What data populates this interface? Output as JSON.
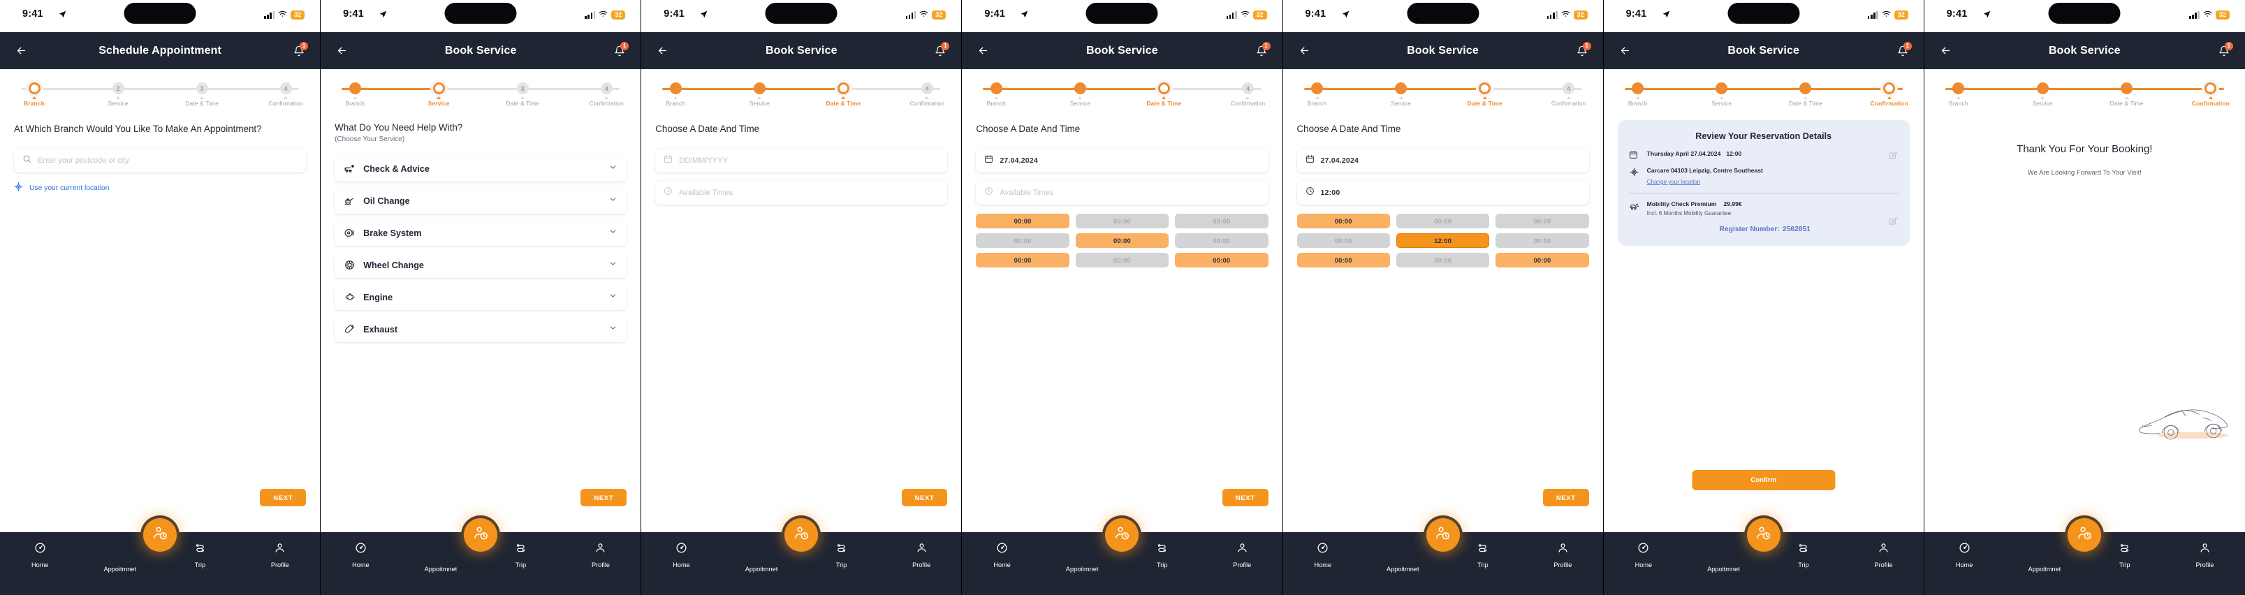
{
  "status_bar": {
    "time": "9:41",
    "battery": "32",
    "location_icon": "navigation-arrow-icon",
    "wifi_icon": "wifi-icon",
    "signal_icon": "signal-bars-icon"
  },
  "tabbar": {
    "home": "Home",
    "appointment": "Appoitmnet",
    "trip": "Trip",
    "profile": "Profile"
  },
  "colors": {
    "accent": "#f5941d",
    "accent_light": "#fbb163",
    "header_bg": "#1f2533",
    "slot_busy": "#d3d4d6",
    "link_blue": "#2a6fe0",
    "card_bg": "#e9edf7"
  },
  "steps": {
    "branch": "Branch",
    "service": "Service",
    "date_time": "Date & Time",
    "confirmation": "Confirmation"
  },
  "screens": [
    {
      "id": "branch",
      "title": "Schedule Appointment",
      "notification_count": "1",
      "active_step": 0,
      "question": "At Which Branch Would You Like To Make An Appointment?",
      "search_placeholder": "Enter your postcode or city",
      "current_location_label": "Use your current location",
      "next_label": "NEXT"
    },
    {
      "id": "service",
      "title": "Book Service",
      "notification_count": "1",
      "active_step": 1,
      "question": "What Do You Need Help With?",
      "subtitle": "(Choose Your Service)",
      "services": [
        {
          "label": "Check & Advice",
          "icon": "car-check-icon"
        },
        {
          "label": "Oil Change",
          "icon": "oil-can-icon"
        },
        {
          "label": "Brake System",
          "icon": "brake-disc-icon"
        },
        {
          "label": "Wheel Change",
          "icon": "wheel-icon"
        },
        {
          "label": "Engine",
          "icon": "engine-icon"
        },
        {
          "label": "Exhaust",
          "icon": "exhaust-icon"
        }
      ],
      "next_label": "NEXT"
    },
    {
      "id": "datetime-empty",
      "title": "Book Service",
      "notification_count": "1",
      "active_step": 2,
      "question": "Choose A Date And Time",
      "date_placeholder": "DD/MM/YYYY",
      "time_placeholder": "Available Times",
      "slots": [],
      "next_label": "NEXT"
    },
    {
      "id": "datetime-slots",
      "title": "Book Service",
      "notification_count": "1",
      "active_step": 2,
      "question": "Choose A Date And Time",
      "date_value": "27.04.2024",
      "time_placeholder": "Available Times",
      "slots": [
        {
          "label": "00:00",
          "state": "free"
        },
        {
          "label": "00:00",
          "state": "busy"
        },
        {
          "label": "00:00",
          "state": "busy"
        },
        {
          "label": "00:00",
          "state": "busy"
        },
        {
          "label": "00:00",
          "state": "free"
        },
        {
          "label": "00:00",
          "state": "busy"
        },
        {
          "label": "00:00",
          "state": "free"
        },
        {
          "label": "00:00",
          "state": "busy"
        },
        {
          "label": "00:00",
          "state": "free"
        }
      ],
      "next_label": "NEXT"
    },
    {
      "id": "datetime-selected",
      "title": "Book Service",
      "notification_count": "1",
      "active_step": 2,
      "question": "Choose A Date And Time",
      "date_value": "27.04.2024",
      "time_value": "12:00",
      "slots": [
        {
          "label": "00:00",
          "state": "free"
        },
        {
          "label": "00:00",
          "state": "busy"
        },
        {
          "label": "00:00",
          "state": "busy"
        },
        {
          "label": "00:00",
          "state": "busy"
        },
        {
          "label": "12:00",
          "state": "sel"
        },
        {
          "label": "00:00",
          "state": "busy"
        },
        {
          "label": "00:00",
          "state": "free"
        },
        {
          "label": "00:00",
          "state": "busy"
        },
        {
          "label": "00:00",
          "state": "free"
        }
      ],
      "next_label": "NEXT"
    },
    {
      "id": "confirmation",
      "title": "Book Service",
      "notification_count": "1",
      "active_step": 3,
      "card": {
        "heading": "Review Your Reservation Details",
        "date_line": "Thursday April 27.04.2024",
        "time_line": "12:00",
        "location_line": "Carcare 04103 Leipzig, Centre Southeast",
        "change_location_label": "Change your location",
        "service_name": "Mobility Check Premium",
        "service_price": "29.99€",
        "service_note": "Incl. 6 Months Mobility Guarantee",
        "register_label": "Register Number:",
        "register_number": "2562851"
      },
      "confirm_label": "Confirm"
    },
    {
      "id": "thankyou",
      "title": "Book Service",
      "notification_count": "1",
      "active_step": 3,
      "thanks_title": "Thank You For Your Booking!",
      "thanks_sub": "We Are Looking Forward To Your Visit!"
    }
  ]
}
